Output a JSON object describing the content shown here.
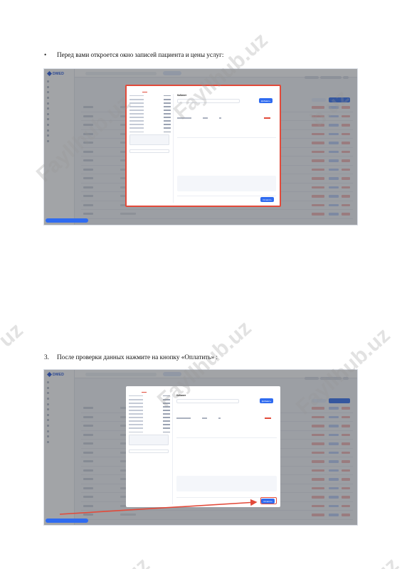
{
  "doc": {
    "bullet_marker": "•",
    "bullet_text": "Перед вами откроется окно записей пациента и цены услуг:",
    "step_number": "3.",
    "step_text": "После проверки данных нажмите на кнопку «Оплатить» :"
  },
  "screenshot": {
    "logo": "DMED",
    "modal_tab_label": "Кабинет",
    "modal_add_button": "Добавить",
    "modal_pay_button": "Оплатить",
    "highlight_color": "#e24a3a",
    "accent_color": "#2f6bf0"
  },
  "watermark": {
    "text": "Fayllhub.uz",
    "text_short": "uz",
    "text_mid": "b.uz"
  }
}
